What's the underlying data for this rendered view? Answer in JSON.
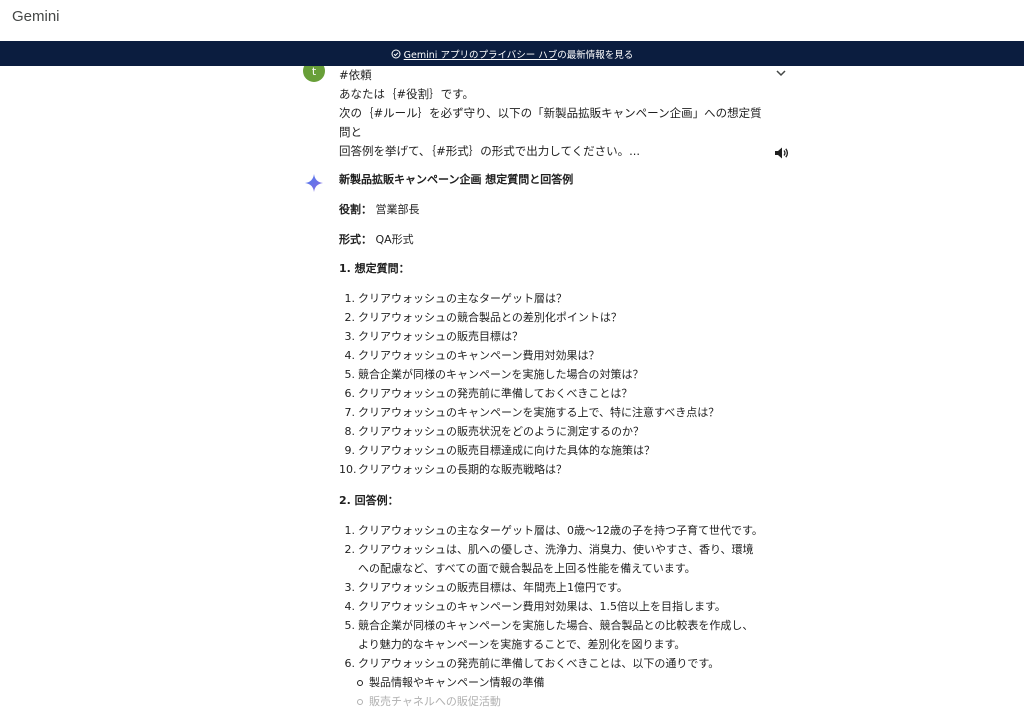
{
  "app": {
    "title": "Gemini"
  },
  "banner": {
    "link_text": "Gemini アプリのプライバシー ハブ",
    "suffix_text": "の最新情報を見る"
  },
  "user": {
    "avatar_letter": "t",
    "message_lines": [
      "#依頼",
      "あなたは｛#役割｝です。",
      "次の｛#ルール｝を必ず守り、以下の「新製品拡販キャンペーン企画」への想定質問と",
      "回答例を挙げて、｛#形式｝の形式で出力してください。..."
    ]
  },
  "response": {
    "title": "新製品拡販キャンペーン企画 想定質問と回答例",
    "role_label": "役割：",
    "role_value": "営業部長",
    "format_label": "形式：",
    "format_value": "QA形式",
    "questions_heading": "1. 想定質問：",
    "questions": [
      "クリアウォッシュの主なターゲット層は？",
      "クリアウォッシュの競合製品との差別化ポイントは？",
      "クリアウォッシュの販売目標は？",
      "クリアウォッシュのキャンペーン費用対効果は？",
      "競合企業が同様のキャンペーンを実施した場合の対策は？",
      "クリアウォッシュの発売前に準備しておくべきことは？",
      "クリアウォッシュのキャンペーンを実施する上で、特に注意すべき点は？",
      "クリアウォッシュの販売状況をどのように測定するのか？",
      "クリアウォッシュの販売目標達成に向けた具体的な施策は？",
      "クリアウォッシュの長期的な販売戦略は？"
    ],
    "answers_heading": "2. 回答例：",
    "answers": [
      {
        "lines": [
          "クリアウォッシュの主なターゲット層は、0歳～12歳の子を持つ子育て世代です。"
        ]
      },
      {
        "lines": [
          "クリアウォッシュは、肌への優しさ、洗浄力、消臭力、使いやすさ、香り、環境",
          "への配慮など、すべての面で競合製品を上回る性能を備えています。"
        ]
      },
      {
        "lines": [
          "クリアウォッシュの販売目標は、年間売上1億円です。"
        ]
      },
      {
        "lines": [
          "クリアウォッシュのキャンペーン費用対効果は、1.5倍以上を目指します。"
        ]
      },
      {
        "lines": [
          "競合企業が同様のキャンペーンを実施した場合、競合製品との比較表を作成し、",
          "より魅力的なキャンペーンを実施することで、差別化を図ります。"
        ]
      },
      {
        "lines": [
          "クリアウォッシュの発売前に準備しておくべきことは、以下の通りです。"
        ]
      }
    ],
    "sub_items": [
      "製品情報やキャンペーン情報の準備",
      "販売チャネルへの販促活動"
    ]
  }
}
